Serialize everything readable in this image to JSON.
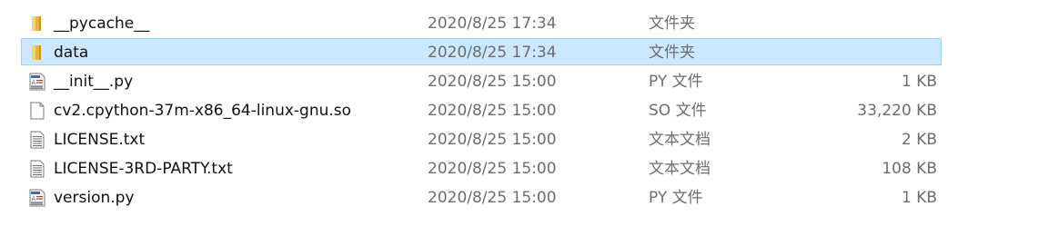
{
  "files": [
    {
      "name": "__pycache__",
      "date": "2020/8/25 17:34",
      "type": "文件夹",
      "size": "",
      "icon": "folder-icon",
      "selected": false
    },
    {
      "name": "data",
      "date": "2020/8/25 17:34",
      "type": "文件夹",
      "size": "",
      "icon": "folder-icon",
      "selected": true
    },
    {
      "name": "__init__.py",
      "date": "2020/8/25 15:00",
      "type": "PY 文件",
      "size": "1 KB",
      "icon": "python-file-icon",
      "selected": false
    },
    {
      "name": "cv2.cpython-37m-x86_64-linux-gnu.so",
      "date": "2020/8/25 15:00",
      "type": "SO 文件",
      "size": "33,220 KB",
      "icon": "blank-file-icon",
      "selected": false
    },
    {
      "name": "LICENSE.txt",
      "date": "2020/8/25 15:00",
      "type": "文本文档",
      "size": "2 KB",
      "icon": "text-file-icon",
      "selected": false
    },
    {
      "name": "LICENSE-3RD-PARTY.txt",
      "date": "2020/8/25 15:00",
      "type": "文本文档",
      "size": "108 KB",
      "icon": "text-file-icon",
      "selected": false
    },
    {
      "name": "version.py",
      "date": "2020/8/25 15:00",
      "type": "PY 文件",
      "size": "1 KB",
      "icon": "python-file-icon",
      "selected": false
    }
  ],
  "colors": {
    "selection_bg": "#cce8ff",
    "selection_border": "#99d1ff",
    "folder": "#f7c948",
    "python_blue": "#3c6fb0"
  }
}
